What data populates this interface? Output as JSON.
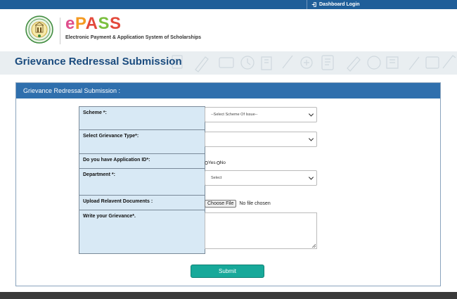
{
  "topbar": {
    "dashboard_login": "Dashboard Login"
  },
  "header": {
    "brand": {
      "e": "e",
      "P": "P",
      "A": "A",
      "S1": "S",
      "S2": "S"
    },
    "tagline": "Electronic Payment & Application System of Scholarships"
  },
  "banner": {
    "title": "Grievance Redressal Submission"
  },
  "form": {
    "panel_title": "Grievance Redressal Submission :",
    "labels": {
      "scheme": "Scheme *:",
      "grievance_type": "Select Grievance Type*:",
      "application_id": "Do you have Application ID*:",
      "department": "Department *:",
      "upload": "Upload Relavent Documents :",
      "grievance": "Write your Grievance*."
    },
    "scheme_select": {
      "value": "--Select Scheme Of Issue--"
    },
    "grievance_type_select": {
      "value": ""
    },
    "application_id_options": [
      "Yes",
      "No"
    ],
    "department_select": {
      "value": "Select"
    },
    "file": {
      "button": "Choose File",
      "status": "No file chosen"
    },
    "grievance_text": {
      "value": ""
    },
    "submit_label": "Submit"
  },
  "colors": {
    "topbar": "#1f5e99",
    "panel_header": "#2f6fad",
    "label_cell": "#d8e9f5",
    "submit": "#17a99a",
    "banner_title": "#1a4b7e"
  }
}
